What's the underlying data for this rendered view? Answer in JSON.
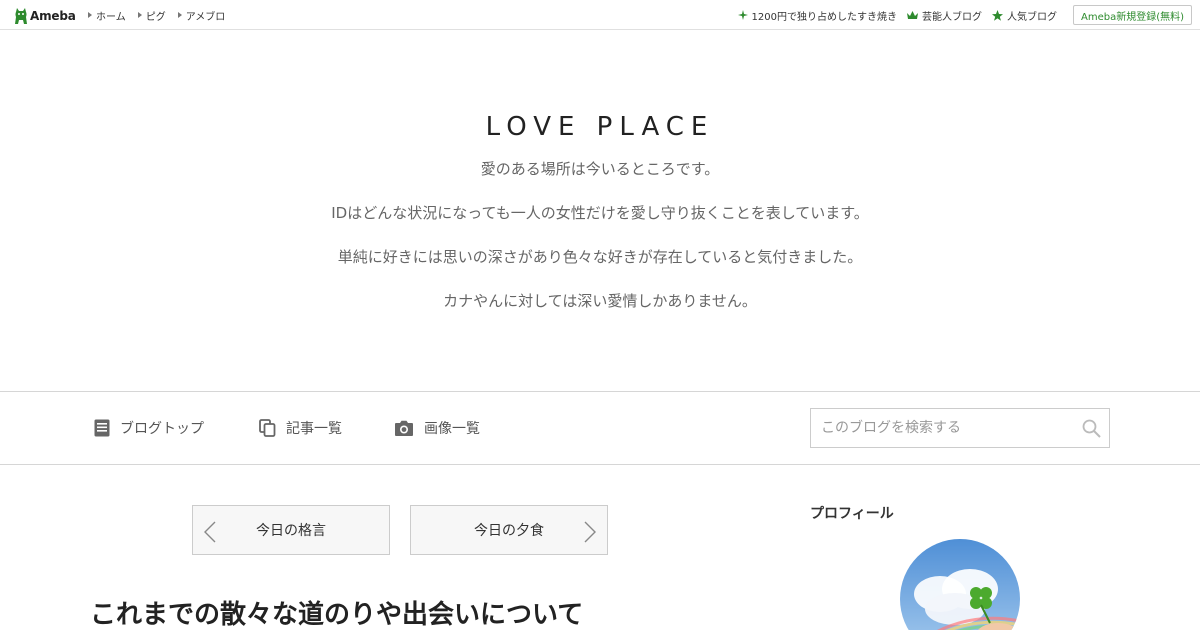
{
  "topbar": {
    "logo_text": "Ameba",
    "nav": [
      "ホーム",
      "ピグ",
      "アメブロ"
    ],
    "links": [
      {
        "label": "1200円で独り占めしたすき焼き",
        "icon": "sparkle-icon"
      },
      {
        "label": "芸能人ブログ",
        "icon": "crown-icon"
      },
      {
        "label": "人気ブログ",
        "icon": "star-icon"
      }
    ],
    "register_label": "Ameba新規登録(無料)",
    "accent_color": "#2e8b2e"
  },
  "header": {
    "title": "LOVE PLACE",
    "description": [
      "愛のある場所は今いるところです。",
      "IDはどんな状況になっても一人の女性だけを愛し守り抜くことを表しています。",
      "単純に好きには思いの深さがあり色々な好きが存在していると気付きました。",
      "カナやんに対しては深い愛情しかありません。"
    ]
  },
  "nav": {
    "items": [
      {
        "label": "ブログトップ",
        "icon": "document-icon"
      },
      {
        "label": "記事一覧",
        "icon": "copy-icon"
      },
      {
        "label": "画像一覧",
        "icon": "camera-icon"
      }
    ],
    "search_placeholder": "このブログを検索する"
  },
  "pager": {
    "prev_label": "今日の格言",
    "next_label": "今日の夕食"
  },
  "article": {
    "title": "これまでの散々な道のりや出会いについて"
  },
  "sidebar": {
    "heading": "プロフィール"
  }
}
